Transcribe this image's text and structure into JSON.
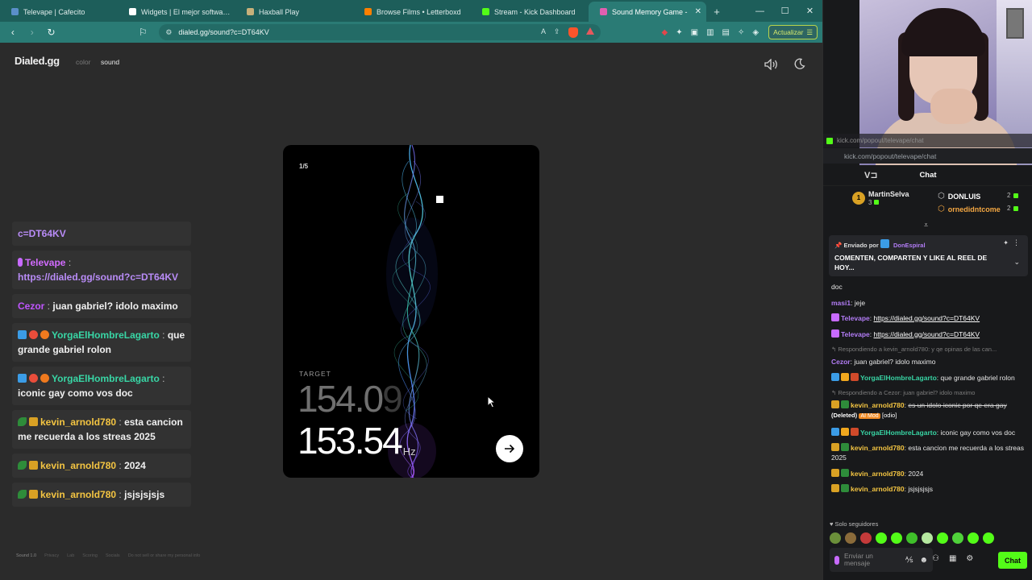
{
  "browser": {
    "tabs": [
      {
        "label": "Televape | Cafecito",
        "color": "#5a8fc9"
      },
      {
        "label": "Widgets | El mejor software para",
        "color": "#ffffff"
      },
      {
        "label": "Haxball Play",
        "color": "#c7b07a"
      },
      {
        "label": "Browse Films • Letterboxd",
        "color": "#ff8000"
      },
      {
        "label": "Stream - Kick Dashboard",
        "color": "#53fc18"
      },
      {
        "label": "Sound Memory Game -",
        "color": "#e05fb0",
        "active": true
      }
    ],
    "url": "dialed.gg/sound?c=DT64KV",
    "update_label": "Actualizar"
  },
  "page": {
    "logo": "Dialed.gg",
    "nav_color": "color",
    "nav_sound": "sound",
    "step": "1/5",
    "target_label": "TARGET",
    "target_value": "154.0",
    "target_value_faded": "9",
    "current_value": "153.54",
    "current_unit": "Hz",
    "footer": [
      "Sound 1.0",
      "Privacy",
      "Lab",
      "Scoring",
      "Socials",
      "Do not sell or share my personal info"
    ]
  },
  "overlay": {
    "messages": [
      {
        "parts": [
          {
            "t": "c=DT64KV",
            "c": "link"
          }
        ]
      },
      {
        "parts": [
          {
            "t": "Televape",
            "c": "usr-tele"
          },
          {
            "t": " : ",
            "c": "sep"
          },
          {
            "t": "https://dialed.gg/sound?c=DT64KV",
            "c": "link"
          }
        ],
        "badges": [
          "mic"
        ]
      },
      {
        "parts": [
          {
            "t": "Cezor",
            "c": "usr-cezor"
          },
          {
            "t": " : ",
            "c": "sep"
          },
          {
            "t": "juan gabriel? idolo maximo",
            "c": ""
          }
        ]
      },
      {
        "parts": [
          {
            "t": "YorgaElHombreLagarto",
            "c": "usr-yorga"
          },
          {
            "t": " : ",
            "c": "sep"
          },
          {
            "t": "que grande gabriel rolon",
            "c": ""
          }
        ],
        "badges": [
          "blue",
          "red",
          "orange"
        ]
      },
      {
        "parts": [
          {
            "t": "YorgaElHombreLagarto",
            "c": "usr-yorga"
          },
          {
            "t": " : ",
            "c": "sep"
          },
          {
            "t": "iconic gay como vos doc",
            "c": ""
          }
        ],
        "badges": [
          "blue",
          "red",
          "orange"
        ]
      },
      {
        "parts": [
          {
            "t": "kevin_arnold780",
            "c": "usr-kevin"
          },
          {
            "t": " : ",
            "c": "sep"
          },
          {
            "t": "esta cancion me recuerda a los streas 2025",
            "c": ""
          }
        ],
        "badges": [
          "leaf",
          "crown"
        ]
      },
      {
        "parts": [
          {
            "t": "kevin_arnold780",
            "c": "usr-kevin"
          },
          {
            "t": " : ",
            "c": "sep"
          },
          {
            "t": "2024",
            "c": ""
          }
        ],
        "badges": [
          "leaf",
          "crown"
        ]
      },
      {
        "parts": [
          {
            "t": "kevin_arnold780",
            "c": "usr-kevin"
          },
          {
            "t": " : ",
            "c": "sep"
          },
          {
            "t": "jsjsjsjsjs",
            "c": ""
          }
        ],
        "badges": [
          "leaf",
          "crown"
        ]
      }
    ]
  },
  "kick": {
    "popup_bar": "kick.com/popout/televape/chat",
    "popup_url": "kick.com/popout/televape/chat",
    "chat_title": "Chat",
    "leaders": [
      {
        "name": "MartinSelva",
        "count": "3",
        "color": "#f4c542"
      },
      {
        "name": "DONLUIS",
        "count": "2",
        "color": "#ffffff"
      },
      {
        "name": "ornedidntcome",
        "count": "2",
        "color": "#f4a742"
      }
    ],
    "pinned_by_label": "Enviado por",
    "pinned_by_name": "DonEspiral",
    "pinned_message": "COMENTEN, COMPARTEN Y LIKE AL REEL DE HOY...",
    "log": [
      {
        "type": "plain",
        "text": "doc"
      },
      {
        "type": "msg",
        "user": "masi1",
        "cls": "c-masi",
        "text": "jeje"
      },
      {
        "type": "link",
        "user": "Televape",
        "cls": "c-tele",
        "text": "https://dialed.gg/sound?c=DT64KV"
      },
      {
        "type": "link",
        "user": "Televape",
        "cls": "c-tele",
        "text": "https://dialed.gg/sound?c=DT64KV"
      },
      {
        "type": "reply",
        "text": "Respondiendo a kevin_arnold780: y qe opinas de las can..."
      },
      {
        "type": "msg",
        "user": "Cezor",
        "cls": "c-cezor",
        "text": "juan gabriel? idolo maximo"
      },
      {
        "type": "msg",
        "user": "YorgaElHombreLagarto",
        "cls": "c-yorga",
        "text": "que grande gabriel rolon"
      },
      {
        "type": "reply",
        "text": "Respondiendo a Cezor: juan gabriel? idolo maximo"
      },
      {
        "type": "deleted",
        "user": "kevin_arnold780",
        "cls": "c-kevin",
        "text": "es un idolo iconic por qe era gay",
        "tag_deleted": "(Deleted)",
        "tag_mod": "AI Mod",
        "tag_odio": "[odio]"
      },
      {
        "type": "msg",
        "user": "YorgaElHombreLagarto",
        "cls": "c-yorga",
        "text": "iconic gay como vos doc"
      },
      {
        "type": "msg",
        "user": "kevin_arnold780",
        "cls": "c-kevin",
        "text": "esta cancion me recuerda a los streas 2025"
      },
      {
        "type": "msg",
        "user": "kevin_arnold780",
        "cls": "c-kevin",
        "text": "2024"
      },
      {
        "type": "msg",
        "user": "kevin_arnold780",
        "cls": "c-kevin",
        "text": "jsjsjsjsjs"
      }
    ],
    "followers_only": "Solo seguidores",
    "composer_placeholder": "Enviar un mensaje",
    "chat_button": "Chat"
  }
}
